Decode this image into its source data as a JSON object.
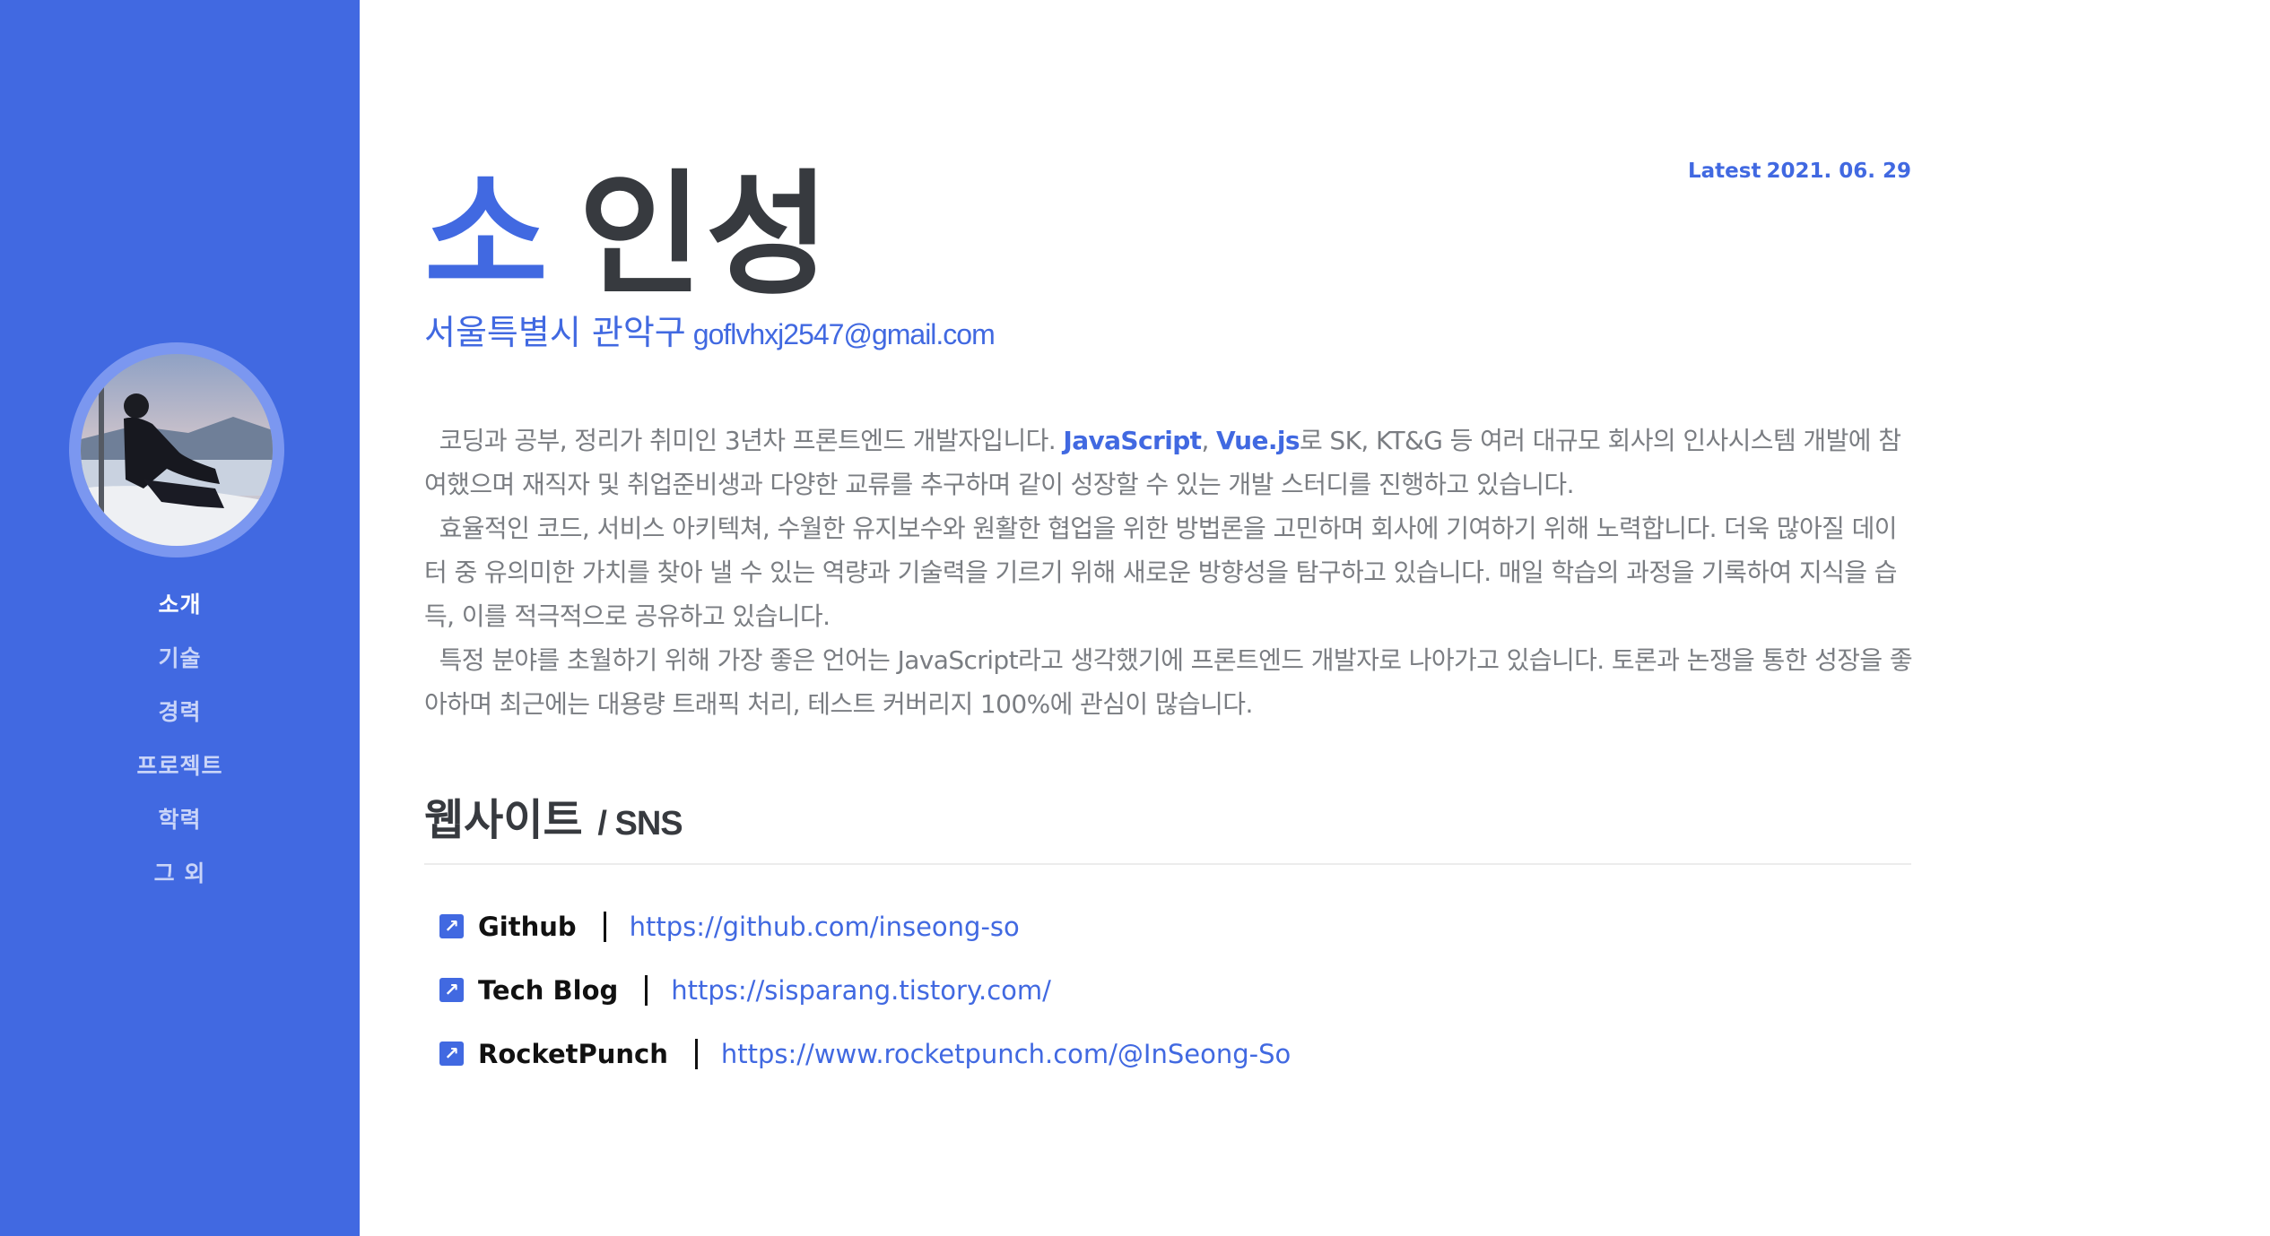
{
  "sidebar": {
    "avatar_alt": "profile photo",
    "nav": [
      {
        "label": "소개",
        "active": true
      },
      {
        "label": "기술"
      },
      {
        "label": "경력"
      },
      {
        "label": "프로젝트"
      },
      {
        "label": "학력"
      },
      {
        "label": "그 외"
      }
    ]
  },
  "header": {
    "latest_label": "Latest",
    "latest_date": "2021. 06. 29",
    "name_first": "소",
    "name_rest": "인성",
    "location": "서울특별시 관악구",
    "email": "goflvhxj2547@gmail.com"
  },
  "intro": {
    "p1_a": "코딩과 공부, 정리가 취미인 3년차 프론트엔드 개발자입니다. ",
    "p1_hl1": "JavaScript",
    "p1_comma": ", ",
    "p1_hl2": "Vue.js",
    "p1_b": "로 SK, KT&G 등 여러 대규모 회사의 인사시스템 개발에 참여했으며 재직자 및 취업준비생과 다양한 교류를 추구하며 같이 성장할 수 있는 개발 스터디를 진행하고 있습니다.",
    "p2": "효율적인 코드, 서비스 아키텍쳐, 수월한 유지보수와 원활한 협업을 위한 방법론을 고민하며 회사에 기여하기 위해 노력합니다. 더욱 많아질 데이터 중 유의미한 가치를 찾아 낼 수 있는 역량과 기술력을 기르기 위해 새로운 방향성을 탐구하고 있습니다. 매일 학습의 과정을 기록하여 지식을 습득, 이를 적극적으로 공유하고 있습니다.",
    "p3": "특정 분야를 초월하기 위해 가장 좋은 언어는 JavaScript라고 생각했기에 프론트엔드 개발자로 나아가고 있습니다. 토론과 논쟁을 통한 성장을 좋아하며 최근에는 대용량 트래픽 처리, 테스트 커버리지 100%에 관심이 많습니다."
  },
  "websites": {
    "title": "웹사이트",
    "title_sub": "/ SNS",
    "links": [
      {
        "name": "Github",
        "url": "https://github.com/inseong-so"
      },
      {
        "name": "Tech Blog",
        "url": "https://sisparang.tistory.com/"
      },
      {
        "name": "RocketPunch",
        "url": "https://www.rocketpunch.com/@InSeong-So"
      }
    ]
  },
  "colors": {
    "accent": "#4169e1",
    "sidebar_bg": "#4169e1",
    "text_dark": "#373a3f",
    "text_body": "#7a7d82"
  },
  "icons": {
    "link_icon": "external-link-arrow-icon"
  }
}
